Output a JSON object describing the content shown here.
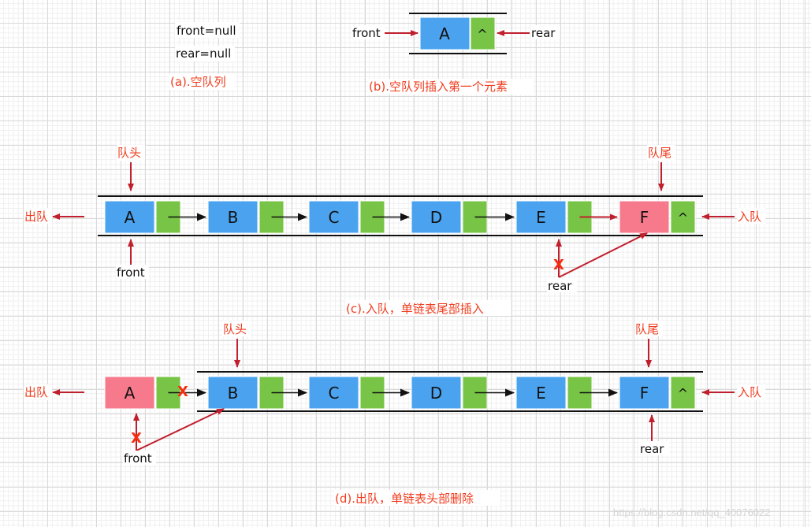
{
  "colors": {
    "data_cell": "#4ba3ef",
    "removed_or_new_cell": "#f67a8b",
    "pointer_cell": "#78c446",
    "arrow_red": "#c0202d",
    "arrow_black": "#111111",
    "text_red": "#f03c1e"
  },
  "panel_a": {
    "front_text": "front=null",
    "rear_text": "rear=null",
    "caption": "(a).空队列"
  },
  "panel_b": {
    "front_label": "front",
    "rear_label": "rear",
    "node": {
      "value": "A",
      "next": "^"
    },
    "caption": "(b).空队列插入第一个元素"
  },
  "panel_c": {
    "head_label": "队头",
    "tail_label": "队尾",
    "dequeue_label": "出队",
    "enqueue_label": "入队",
    "front_label": "front",
    "rear_label": "rear",
    "old_rear_cross": "X",
    "nodes": [
      {
        "value": "A",
        "next": "",
        "state": "normal"
      },
      {
        "value": "B",
        "next": "",
        "state": "normal"
      },
      {
        "value": "C",
        "next": "",
        "state": "normal"
      },
      {
        "value": "D",
        "next": "",
        "state": "normal"
      },
      {
        "value": "E",
        "next": "",
        "state": "normal"
      },
      {
        "value": "F",
        "next": "^",
        "state": "new"
      }
    ],
    "caption": "(c).入队，单链表尾部插入"
  },
  "panel_d": {
    "head_label": "队头",
    "tail_label": "队尾",
    "dequeue_label": "出队",
    "enqueue_label": "入队",
    "front_label": "front",
    "rear_label": "rear",
    "link_cross": "X",
    "old_front_cross": "X",
    "nodes": [
      {
        "value": "A",
        "next": "",
        "state": "removed"
      },
      {
        "value": "B",
        "next": "",
        "state": "normal"
      },
      {
        "value": "C",
        "next": "",
        "state": "normal"
      },
      {
        "value": "D",
        "next": "",
        "state": "normal"
      },
      {
        "value": "E",
        "next": "",
        "state": "normal"
      },
      {
        "value": "F",
        "next": "^",
        "state": "normal"
      }
    ],
    "caption": "(d).出队，单链表头部删除"
  },
  "watermark": "https://blog.csdn.net/qq_40076022"
}
